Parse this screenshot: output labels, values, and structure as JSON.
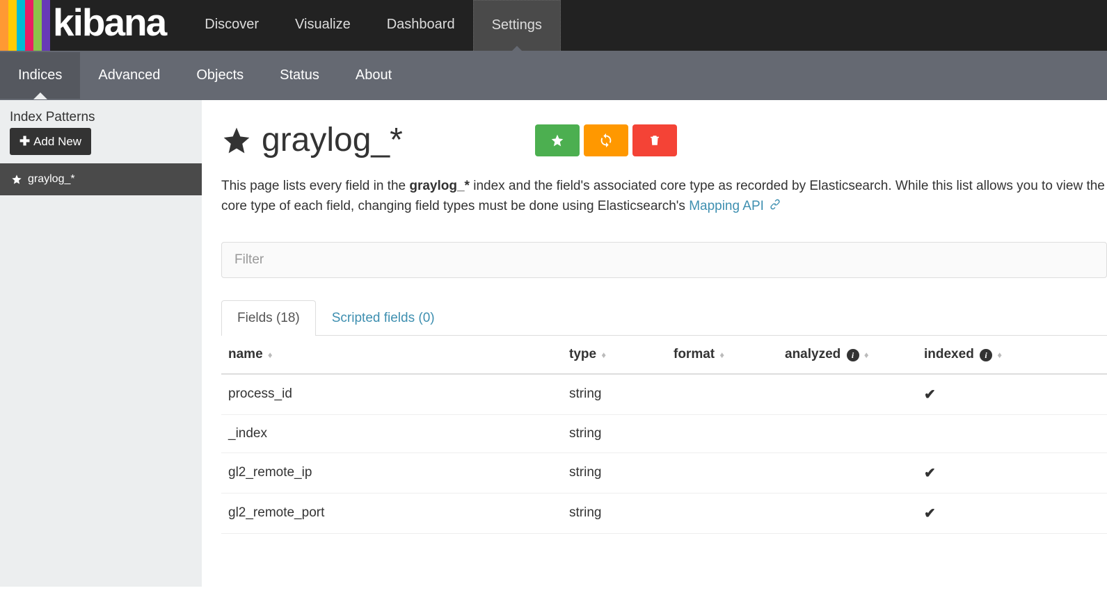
{
  "logo": {
    "text": "kibana",
    "stripe_colors": [
      "#ff9933",
      "#ffcc00",
      "#00bcd4",
      "#e91e63",
      "#8bc34a",
      "#673ab7"
    ]
  },
  "top_nav": {
    "items": [
      "Discover",
      "Visualize",
      "Dashboard",
      "Settings"
    ],
    "active_index": 3
  },
  "sub_nav": {
    "items": [
      "Indices",
      "Advanced",
      "Objects",
      "Status",
      "About"
    ],
    "active_index": 0
  },
  "sidebar": {
    "header": "Index Patterns",
    "add_new_label": "Add New",
    "patterns": [
      "graylog_*"
    ],
    "active_pattern_index": 0
  },
  "page": {
    "title": "graylog_*",
    "description_prefix": "This page lists every field in the ",
    "description_bold": "graylog_*",
    "description_mid": " index and the field's associated core type as recorded by Elasticsearch. While this list allows you to view the core type of each field, changing field types must be done using Elasticsearch's ",
    "description_link": "Mapping API"
  },
  "filter": {
    "placeholder": "Filter"
  },
  "tabs": {
    "fields_label": "Fields (18)",
    "scripted_label": "Scripted fields (0)"
  },
  "table": {
    "columns": {
      "name": "name",
      "type": "type",
      "format": "format",
      "analyzed": "analyzed",
      "indexed": "indexed"
    },
    "rows": [
      {
        "name": "process_id",
        "type": "string",
        "format": "",
        "analyzed": false,
        "indexed": true
      },
      {
        "name": "_index",
        "type": "string",
        "format": "",
        "analyzed": false,
        "indexed": false
      },
      {
        "name": "gl2_remote_ip",
        "type": "string",
        "format": "",
        "analyzed": false,
        "indexed": true
      },
      {
        "name": "gl2_remote_port",
        "type": "string",
        "format": "",
        "analyzed": false,
        "indexed": true
      }
    ]
  }
}
